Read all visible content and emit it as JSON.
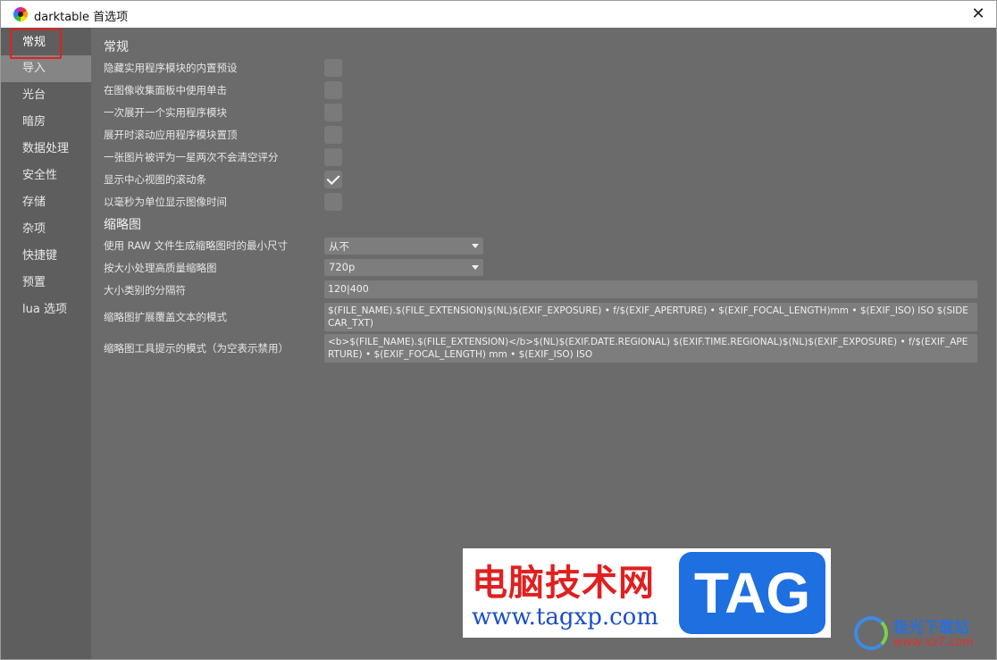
{
  "window": {
    "title": "darktable 首选项"
  },
  "sidebar": {
    "items": [
      {
        "label": "常规"
      },
      {
        "label": "导入"
      },
      {
        "label": "光台"
      },
      {
        "label": "暗房"
      },
      {
        "label": "数据处理"
      },
      {
        "label": "安全性"
      },
      {
        "label": "存储"
      },
      {
        "label": "杂项"
      },
      {
        "label": "快捷键"
      },
      {
        "label": "预置"
      },
      {
        "label": "lua 选项"
      }
    ],
    "active_item": "常规",
    "hovered_item": "导入"
  },
  "general": {
    "section_title": "常规",
    "options": [
      {
        "label": "隐藏实用程序模块的内置预设",
        "checked": false
      },
      {
        "label": "在图像收集面板中使用单击",
        "checked": false
      },
      {
        "label": "一次展开一个实用程序模块",
        "checked": false
      },
      {
        "label": "展开时滚动应用程序模块置顶",
        "checked": false
      },
      {
        "label": "一张图片被评为一星两次不会清空评分",
        "checked": false
      },
      {
        "label": "显示中心视图的滚动条",
        "checked": true
      },
      {
        "label": "以毫秒为单位显示图像时间",
        "checked": false
      }
    ]
  },
  "thumbnails": {
    "section_title": "缩略图",
    "min_size_label": "使用 RAW 文件生成缩略图时的最小尺寸",
    "min_size_value": "从不",
    "hq_label": "按大小处理高质量缩略图",
    "hq_value": "720p",
    "separator_label": "大小类别的分隔符",
    "separator_value": "120|400",
    "overlay_label": "缩略图扩展覆盖文本的模式",
    "overlay_value": "$(FILE_NAME).$(FILE_EXTENSION)$(NL)$(EXIF_EXPOSURE) • f/$(EXIF_APERTURE) • $(EXIF_FOCAL_LENGTH)mm • $(EXIF_ISO) ISO $(SIDECAR_TXT)",
    "tooltip_label": "缩略图工具提示的模式（为空表示禁用）",
    "tooltip_value": "<b>$(FILE_NAME).$(FILE_EXTENSION)</b>$(NL)$(EXIF.DATE.REGIONAL) $(EXIF.TIME.REGIONAL)$(NL)$(EXIF_EXPOSURE) • f/$(EXIF_APERTURE) • $(EXIF_FOCAL_LENGTH) mm • $(EXIF_ISO) ISO"
  },
  "watermark": {
    "cn_text": "电脑技术网",
    "url": "www.tagxp.com",
    "tag": "TAG"
  },
  "corner_logo": {
    "cn_text": "极光下载站",
    "url": "www.xz7.com"
  },
  "colors": {
    "sidebar_bg": "#5e5e5e",
    "content_bg": "#6b6b6b",
    "hover_bg": "#858585",
    "highlight_red": "#e02020"
  }
}
